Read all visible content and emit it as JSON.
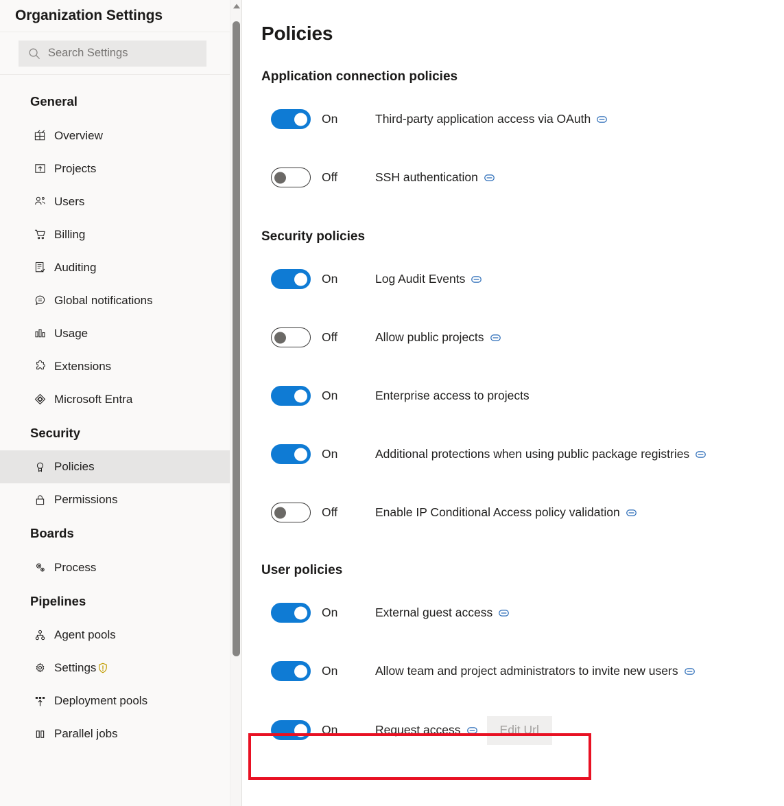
{
  "sidebar": {
    "title": "Organization Settings",
    "search": {
      "placeholder": "Search Settings",
      "value": "",
      "icon": "search-icon"
    },
    "groups": [
      {
        "title": "General",
        "items": [
          {
            "label": "Overview",
            "icon": "overview-icon",
            "selected": false
          },
          {
            "label": "Projects",
            "icon": "projects-icon",
            "selected": false
          },
          {
            "label": "Users",
            "icon": "users-icon",
            "selected": false
          },
          {
            "label": "Billing",
            "icon": "billing-cart-icon",
            "selected": false
          },
          {
            "label": "Auditing",
            "icon": "auditing-list-icon",
            "selected": false
          },
          {
            "label": "Global notifications",
            "icon": "notification-chat-icon",
            "selected": false
          },
          {
            "label": "Usage",
            "icon": "usage-bar-chart-icon",
            "selected": false
          },
          {
            "label": "Extensions",
            "icon": "extensions-puzzle-icon",
            "selected": false
          },
          {
            "label": "Microsoft Entra",
            "icon": "microsoft-entra-icon",
            "selected": false
          }
        ]
      },
      {
        "title": "Security",
        "items": [
          {
            "label": "Policies",
            "icon": "policies-ribbon-icon",
            "selected": true
          },
          {
            "label": "Permissions",
            "icon": "permissions-lock-icon",
            "selected": false
          }
        ]
      },
      {
        "title": "Boards",
        "items": [
          {
            "label": "Process",
            "icon": "process-gears-icon",
            "selected": false
          }
        ]
      },
      {
        "title": "Pipelines",
        "items": [
          {
            "label": "Agent pools",
            "icon": "agent-pools-icon",
            "selected": false
          },
          {
            "label": "Settings",
            "icon": "settings-gear-icon",
            "selected": false,
            "badge": "warning-shield-icon"
          },
          {
            "label": "Deployment pools",
            "icon": "deployment-pools-icon",
            "selected": false
          },
          {
            "label": "Parallel jobs",
            "icon": "parallel-jobs-icon",
            "selected": false
          }
        ]
      }
    ]
  },
  "main": {
    "page_title": "Policies",
    "sections": [
      {
        "title": "Application connection policies",
        "policies": [
          {
            "state": "On",
            "on": true,
            "name": "Third-party application access via OAuth",
            "has_link": true
          },
          {
            "state": "Off",
            "on": false,
            "name": "SSH authentication",
            "has_link": true
          }
        ]
      },
      {
        "title": "Security policies",
        "policies": [
          {
            "state": "On",
            "on": true,
            "name": "Log Audit Events",
            "has_link": true
          },
          {
            "state": "Off",
            "on": false,
            "name": "Allow public projects",
            "has_link": true
          },
          {
            "state": "On",
            "on": true,
            "name": "Enterprise access to projects",
            "has_link": false
          },
          {
            "state": "On",
            "on": true,
            "name": "Additional protections when using public package registries",
            "has_link": true
          },
          {
            "state": "Off",
            "on": false,
            "name": "Enable IP Conditional Access policy validation",
            "has_link": true
          }
        ]
      },
      {
        "title": "User policies",
        "policies": [
          {
            "state": "On",
            "on": true,
            "name": "External guest access",
            "has_link": true
          },
          {
            "state": "On",
            "on": true,
            "name": "Allow team and project administrators to invite new users",
            "has_link": true
          },
          {
            "state": "On",
            "on": true,
            "name": "Request access",
            "has_link": true,
            "button": "Edit Url",
            "button_disabled": true,
            "highlighted": true
          }
        ]
      }
    ]
  },
  "colors": {
    "accent_blue": "#0f7bd4",
    "highlight_red": "#e81123",
    "sidebar_bg": "#faf9f8",
    "selected_item_bg": "#e6e5e4",
    "warning_amber": "#c19c00"
  }
}
